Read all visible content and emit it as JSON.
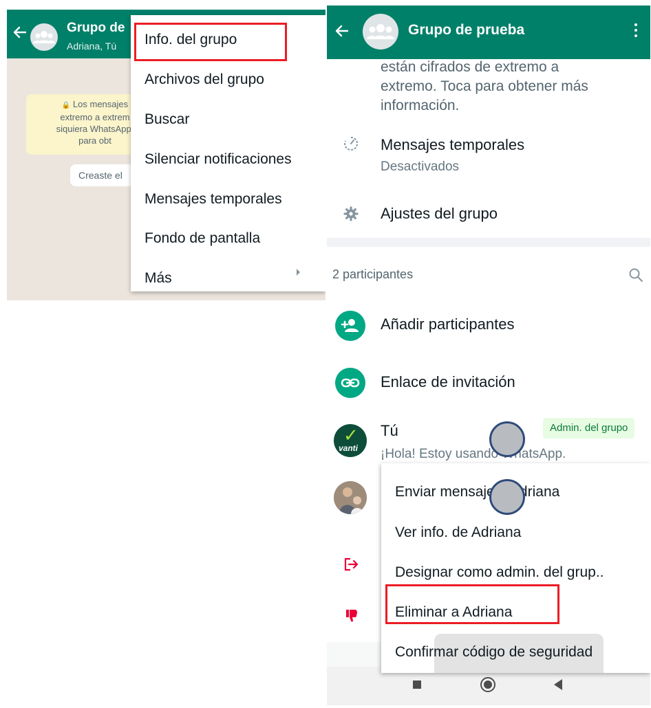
{
  "left_screen": {
    "header": {
      "title": "Grupo de",
      "subtitle": "Adriana, Tú"
    },
    "encryption_notice_lines": [
      "Los mensajes",
      "extremo a extrem",
      "siquiera WhatsApp,",
      "para obt"
    ],
    "created_label": "Creaste el",
    "menu": {
      "items": [
        "Info. del grupo",
        "Archivos del grupo",
        "Buscar",
        "Silenciar notificaciones",
        "Mensajes temporales",
        "Fondo de pantalla",
        "Más"
      ],
      "highlighted_item": "Info. del grupo"
    }
  },
  "right_screen": {
    "header": {
      "title": "Grupo de prueba"
    },
    "encryption_notice_lines": [
      "están cifrados de extremo a",
      "extremo. Toca para obtener más",
      "información."
    ],
    "settings": [
      {
        "title": "Mensajes temporales",
        "subtitle": "Desactivados",
        "icon": "timer-icon"
      },
      {
        "title": "Ajustes del grupo",
        "icon": "gear-icon"
      }
    ],
    "participants_header": "2 participantes",
    "actions": [
      {
        "label": "Añadir participantes",
        "icon": "add-person-icon"
      },
      {
        "label": "Enlace de invitación",
        "icon": "link-icon"
      }
    ],
    "members": [
      {
        "name": "Tú",
        "status": "¡Hola! Estoy usando WhatsApp.",
        "badge": "Admin. del grupo",
        "avatar_text": "vanti"
      }
    ],
    "context_menu": {
      "items": [
        "Enviar mensaje a Adriana",
        "Ver info. de Adriana",
        "Designar como admin. del grup..",
        "Eliminar a Adriana",
        "Confirmar código de seguridad"
      ],
      "highlighted_item": "Eliminar a Adriana"
    }
  },
  "colors": {
    "header_green": "#008069",
    "accent_green": "#00a884",
    "highlight_red": "#ec1c24",
    "danger_red": "#ea0038"
  }
}
